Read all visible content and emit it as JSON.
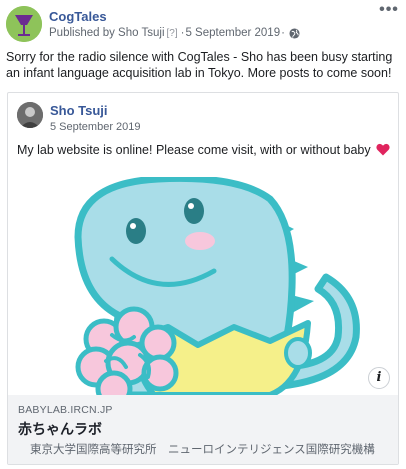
{
  "post": {
    "page_name": "CogTales",
    "published_by": "Published by Sho Tsuji",
    "help_marker": "[?]",
    "separator": "·",
    "date": "5 September 2019",
    "audience_icon": "globe-icon",
    "more_icon": "more-options-icon",
    "more_glyph": "•••",
    "text": "Sorry for the radio silence with CogTales - Sho has been busy starting an infant language acquisition lab in Tokyo. More posts to come soon!"
  },
  "shared": {
    "author": "Sho Tsuji",
    "date": "5 September 2019",
    "text": "My lab website is online! Please come visit, with or without baby",
    "emoji_icon": "red-heart-icon"
  },
  "link": {
    "info_glyph": "i",
    "domain": "BABYLAB.IRCN.JP",
    "title": "赤ちゃんラボ",
    "description": "東京大学国際高等研究所　ニューロインテリジェンス国際研究機構"
  },
  "colors": {
    "link_blue": "#385898",
    "meta_gray": "#606770",
    "dino_teal": "#3bbdc6",
    "dino_fill": "#a9dde8",
    "brain_pink": "#f7c7dc",
    "eggshell_yellow": "#f5f08a",
    "heart_red": "#e0245e"
  }
}
